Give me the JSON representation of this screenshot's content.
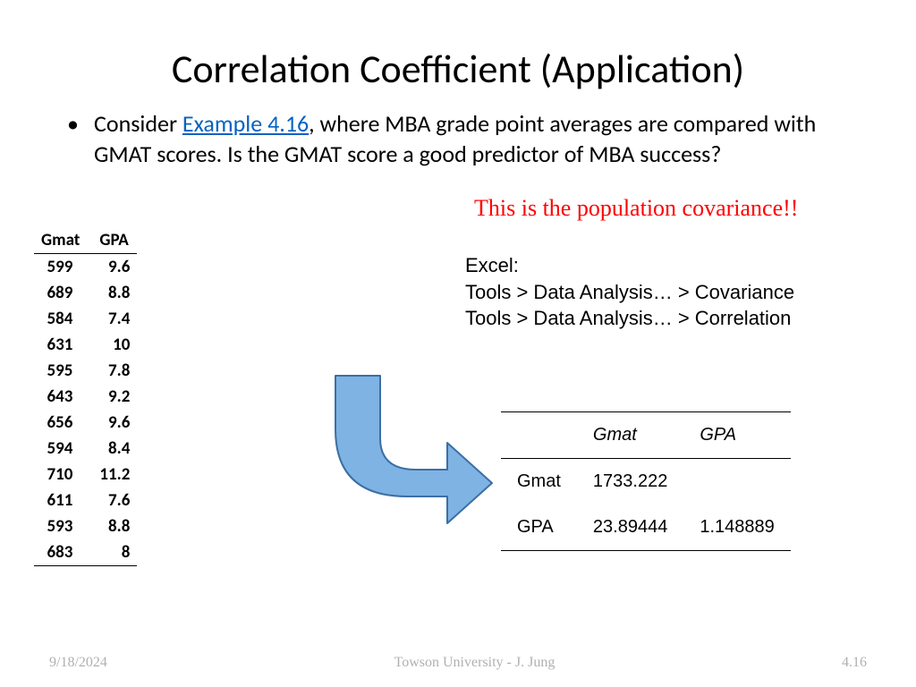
{
  "title": "Correlation Coefficient (Application)",
  "bullet": {
    "pre": "Consider ",
    "link": "Example 4.16",
    "post": ", where MBA grade point averages are compared with GMAT scores. Is the GMAT score a good predictor of MBA success?"
  },
  "covariance_note": "This is the population covariance!!",
  "excel": {
    "title": "Excel:",
    "line1": "Tools > Data Analysis… > Covariance",
    "line2": "Tools > Data Analysis… > Correlation"
  },
  "data_table": {
    "headers": [
      "Gmat",
      "GPA"
    ],
    "rows": [
      [
        "599",
        "9.6"
      ],
      [
        "689",
        "8.8"
      ],
      [
        "584",
        "7.4"
      ],
      [
        "631",
        "10"
      ],
      [
        "595",
        "7.8"
      ],
      [
        "643",
        "9.2"
      ],
      [
        "656",
        "9.6"
      ],
      [
        "594",
        "8.4"
      ],
      [
        "710",
        "11.2"
      ],
      [
        "611",
        "7.6"
      ],
      [
        "593",
        "8.8"
      ],
      [
        "683",
        "8"
      ]
    ]
  },
  "cov_table": {
    "headers": [
      "",
      "Gmat",
      "GPA"
    ],
    "rows": [
      [
        "Gmat",
        "1733.222",
        ""
      ],
      [
        "GPA",
        "23.89444",
        "1.148889"
      ]
    ]
  },
  "footer": {
    "date": "9/18/2024",
    "center": "Towson University - J. Jung",
    "page": "4.16"
  },
  "chart_data": {
    "type": "table",
    "title": "GMAT vs GPA raw data and covariance matrix",
    "raw": {
      "columns": [
        "Gmat",
        "GPA"
      ],
      "rows": [
        [
          599,
          9.6
        ],
        [
          689,
          8.8
        ],
        [
          584,
          7.4
        ],
        [
          631,
          10.0
        ],
        [
          595,
          7.8
        ],
        [
          643,
          9.2
        ],
        [
          656,
          9.6
        ],
        [
          594,
          8.4
        ],
        [
          710,
          11.2
        ],
        [
          611,
          7.6
        ],
        [
          593,
          8.8
        ],
        [
          683,
          8.0
        ]
      ]
    },
    "covariance_matrix": {
      "labels": [
        "Gmat",
        "GPA"
      ],
      "values": [
        [
          1733.222,
          null
        ],
        [
          23.89444,
          1.148889
        ]
      ]
    }
  }
}
